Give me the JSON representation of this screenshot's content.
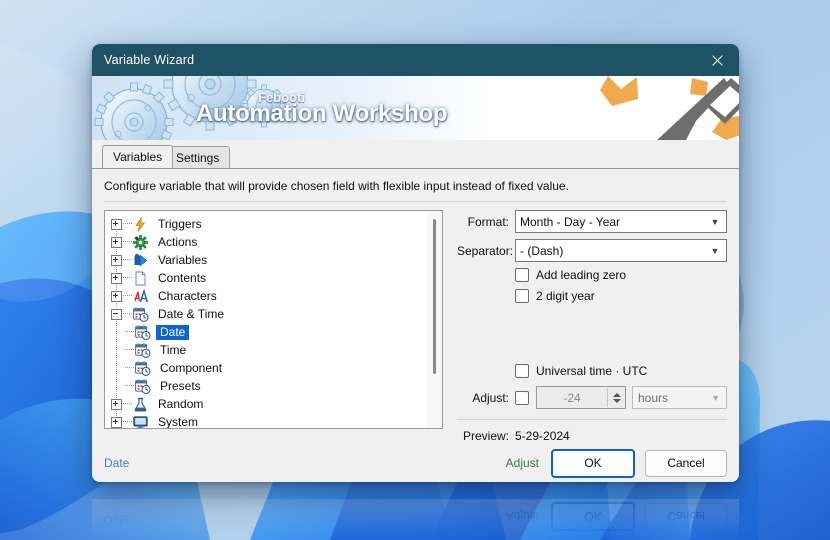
{
  "window": {
    "title": "Variable Wizard",
    "close_icon": "close-icon",
    "titlebar_color": "#1f5265"
  },
  "banner": {
    "brand_small": "Febooti",
    "brand_big": "Automation Workshop",
    "gear_icon": "gears-icon",
    "wand_icon": "eraser-wand-icon",
    "star_icon": "star-icon",
    "accent_orange": "#eeaa4d",
    "accent_gray": "#6e6e6e"
  },
  "tabs": [
    {
      "label": "Variables",
      "active": true
    },
    {
      "label": "Settings",
      "active": false
    }
  ],
  "description": "Configure variable that will provide chosen field with flexible input instead of fixed value.",
  "tree": {
    "items": [
      {
        "label": "Triggers",
        "level": 1,
        "expander": "plus",
        "icon": "lightning-icon",
        "selected": false
      },
      {
        "label": "Actions",
        "level": 1,
        "expander": "plus",
        "icon": "gear-icon",
        "selected": false
      },
      {
        "label": "Variables",
        "level": 1,
        "expander": "plus",
        "icon": "variable-arrow-icon",
        "selected": false
      },
      {
        "label": "Contents",
        "level": 1,
        "expander": "plus",
        "icon": "document-icon",
        "selected": false
      },
      {
        "label": "Characters",
        "level": 1,
        "expander": "plus",
        "icon": "letter-a-icon",
        "selected": false
      },
      {
        "label": "Date & Time",
        "level": 1,
        "expander": "minus",
        "icon": "calendar-clock-icon",
        "selected": false
      },
      {
        "label": "Date",
        "level": 2,
        "expander": "none",
        "icon": "calendar-clock-icon",
        "selected": true
      },
      {
        "label": "Time",
        "level": 2,
        "expander": "none",
        "icon": "calendar-clock-icon",
        "selected": false
      },
      {
        "label": "Component",
        "level": 2,
        "expander": "none",
        "icon": "calendar-clock-icon",
        "selected": false
      },
      {
        "label": "Presets",
        "level": 2,
        "expander": "none",
        "icon": "calendar-clock-icon",
        "selected": false
      },
      {
        "label": "Random",
        "level": 1,
        "expander": "plus",
        "icon": "flask-icon",
        "selected": false
      },
      {
        "label": "System",
        "level": 1,
        "expander": "plus",
        "icon": "monitor-icon",
        "selected": false
      }
    ],
    "selection_color": "#0a67d0",
    "scrollbar": "vertical-scrollbar"
  },
  "options": {
    "format_label": "Format:",
    "format_value": "Month - Day - Year",
    "separator_label": "Separator:",
    "separator_value": "- (Dash)",
    "leading_zero_label": "Add leading zero",
    "leading_zero_checked": false,
    "two_digit_year_label": "2 digit year",
    "two_digit_year_checked": false,
    "utc_label": "Universal time · UTC",
    "utc_checked": false,
    "adjust_label": "Adjust:",
    "adjust_checked": false,
    "adjust_value": "-24",
    "adjust_unit": "hours",
    "preview_label": "Preview:",
    "preview_value": "5-29-2024"
  },
  "footer": {
    "link_label": "Date",
    "adjust_link": "Adjust",
    "ok_label": "OK",
    "cancel_label": "Cancel",
    "link_color": "#4a7ebb",
    "adjust_color": "#3e7d3e",
    "primary_border": "#0a62c2"
  }
}
